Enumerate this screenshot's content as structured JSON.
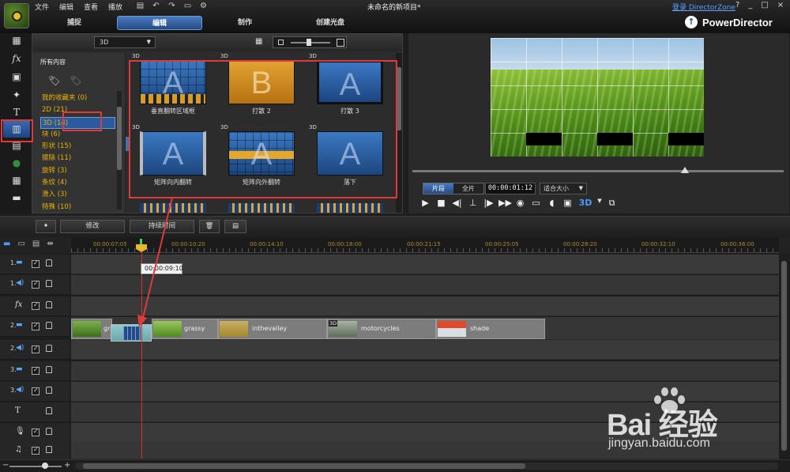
{
  "menu": [
    "文件",
    "编辑",
    "查看",
    "播放"
  ],
  "document_title": "未命名的新项目*",
  "directorzone_link": "登录 DirectorZone",
  "window_controls": [
    "?",
    "_",
    "□",
    "×"
  ],
  "mode_tabs": [
    {
      "label": "捕捉",
      "active": false
    },
    {
      "label": "编辑",
      "active": true
    },
    {
      "label": "制作",
      "active": false
    },
    {
      "label": "创建光盘",
      "active": false
    }
  ],
  "brand": "PowerDirector",
  "library": {
    "dropdown": "3D",
    "category_header": "所有内容",
    "categories": [
      {
        "label": "我的收藏夹  (0)",
        "selected": false
      },
      {
        "label": "2D  (21)",
        "selected": false
      },
      {
        "label": "3D  (14)",
        "selected": true
      },
      {
        "label": "块  (6)",
        "selected": false
      },
      {
        "label": "形状  (15)",
        "selected": false
      },
      {
        "label": "擦除  (11)",
        "selected": false
      },
      {
        "label": "旋转  (3)",
        "selected": false
      },
      {
        "label": "条纹  (4)",
        "selected": false
      },
      {
        "label": "滑入  (3)",
        "selected": false
      },
      {
        "label": "特殊  (10)",
        "selected": false
      }
    ],
    "thumbnails": [
      {
        "tag": "3D",
        "letter": "A",
        "style": "bars",
        "caption": "垂直翻转区域框"
      },
      {
        "tag": "3D",
        "letter": "B",
        "style": "gold",
        "caption": "打散 2"
      },
      {
        "tag": "3D",
        "letter": "A",
        "style": "plain",
        "caption": "打散 3"
      },
      {
        "tag": "3D",
        "letter": "A",
        "style": "plain",
        "caption": "矩阵向内翻转"
      },
      {
        "tag": "3D",
        "letter": "A",
        "style": "mid",
        "caption": "矩阵向外翻转"
      },
      {
        "tag": "3D",
        "letter": "A",
        "style": "plain",
        "caption": "落下"
      }
    ]
  },
  "preview": {
    "segment_tabs": [
      {
        "label": "片段",
        "active": true
      },
      {
        "label": "全片",
        "active": false
      }
    ],
    "timecode": "00:00:01:12",
    "fit_option": "适合大小",
    "badge_3d": "3D"
  },
  "tools_row": {
    "modify": "修改",
    "duration": "持续时间"
  },
  "timeline": {
    "ruler_ticks": [
      "00:00:07:05",
      "00:00:10:20",
      "00:00:14:10",
      "00:00:18:00",
      "00:00:21:15",
      "00:00:25:05",
      "00:00:28:20",
      "00:00:32:10",
      "00:00:36:00"
    ],
    "playhead_tooltip": "00:00:09:10",
    "tracks": [
      {
        "num": "1.",
        "icon": "video"
      },
      {
        "num": "1.",
        "icon": "audio"
      },
      {
        "num": "",
        "icon": "fx"
      },
      {
        "num": "2.",
        "icon": "video"
      },
      {
        "num": "2.",
        "icon": "audio"
      },
      {
        "num": "3.",
        "icon": "video"
      },
      {
        "num": "3.",
        "icon": "audio"
      },
      {
        "num": "",
        "icon": "title"
      },
      {
        "num": "",
        "icon": "voice"
      },
      {
        "num": "",
        "icon": "music"
      }
    ],
    "clips": [
      {
        "label": "gr",
        "tag": ""
      },
      {
        "label": "grassy",
        "tag": ""
      },
      {
        "label": "inthevalley",
        "tag": ""
      },
      {
        "label": "motorcycles",
        "tag": "3D"
      },
      {
        "label": "shade",
        "tag": ""
      }
    ]
  },
  "watermark": {
    "brand": "Bai  经验",
    "url": "jingyan.baidu.com"
  },
  "colors": {
    "accent": "#2c5a9e",
    "category_text": "#e9b300",
    "annotation_red": "#e0393a",
    "playhead": "#d83030",
    "tick_text": "#a88b2c"
  }
}
